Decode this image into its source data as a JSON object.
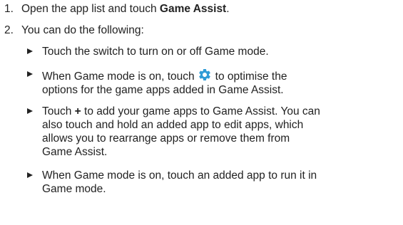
{
  "steps": [
    {
      "number": "1.",
      "text_before": "Open the app list and touch ",
      "bold": "Game Assist",
      "text_after": "."
    },
    {
      "number": "2.",
      "text": "You can do the following:"
    }
  ],
  "bullets": [
    {
      "text": "Touch the switch to turn on or off Game mode."
    },
    {
      "line1_before": "When Game mode is on, touch",
      "icon": "gear-icon",
      "line1_after": "to optimise the",
      "line2": "options for the game apps added in Game Assist."
    },
    {
      "lines": [
        "Touch + to add your game apps to Game Assist. You can",
        "also touch and hold an added app to edit apps, which",
        "allows you to rearrange apps or remove them from",
        "Game Assist."
      ],
      "plus_symbol": "+"
    },
    {
      "lines": [
        "When Game mode is on, touch an added app to run it in",
        "Game mode."
      ]
    }
  ],
  "colors": {
    "text": "#222222",
    "gear_icon": "#2f9bd6"
  }
}
